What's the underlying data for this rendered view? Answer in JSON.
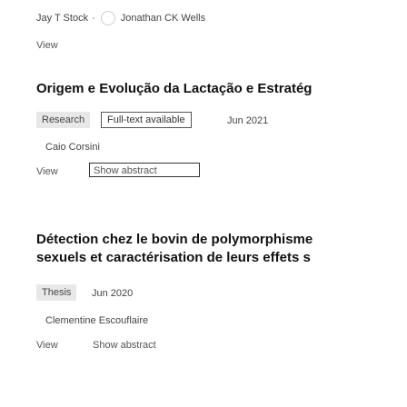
{
  "entry_top": {
    "authors": [
      "Jay T Stock",
      "Jonathan CK Wells"
    ],
    "separator": "·",
    "view_label": "View"
  },
  "entry_2": {
    "title": "Origem e Evolução da Lactação e Estratég",
    "type_badge": "Research",
    "fulltext_badge": "Full-text available",
    "date": "Jun 2021",
    "author": "Caio Corsini",
    "view_label": "View",
    "abstract_label": "Show abstract"
  },
  "entry_3": {
    "title_line1": "Détection chez le bovin de polymorphisme",
    "title_line2": "sexuels et caractérisation de leurs effets s",
    "type_badge": "Thesis",
    "date": "Jun 2020",
    "author": "Clementine Escouflaire",
    "view_label": "View",
    "abstract_label": "Show abstract"
  }
}
